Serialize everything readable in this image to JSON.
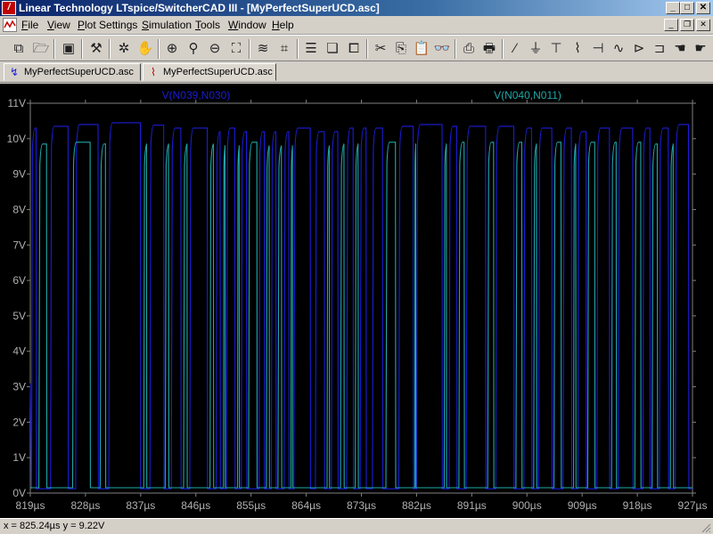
{
  "window": {
    "title": "Linear Technology LTspice/SwitcherCAD III - [MyPerfectSuperUCD.asc]",
    "minimize_glyph": "_",
    "maximize_glyph": "□",
    "close_glyph": "✕"
  },
  "menu": {
    "items": [
      "File",
      "View",
      "Plot Settings",
      "Simulation",
      "Tools",
      "Window",
      "Help"
    ]
  },
  "mdi": {
    "minimize_glyph": "_",
    "restore_glyph": "❐",
    "close_glyph": "✕"
  },
  "toolbar": {
    "icons": [
      "hierarchy-icon",
      "open-folder-icon",
      "save-icon",
      "control-panel-icon",
      "run-icon",
      "pan-hand-icon",
      "zoom-in-icon",
      "zoom-area-icon",
      "zoom-out-icon",
      "zoom-fit-icon",
      "autorange-icon",
      "delete-trace-icon",
      "tile-icon",
      "cascade-icon",
      "close-all-icon",
      "cut-icon",
      "copy-icon",
      "paste-icon",
      "find-icon",
      "print-preview-icon",
      "print-icon",
      "wire-icon",
      "ground-icon",
      "label-icon",
      "resistor-icon",
      "capacitor-icon",
      "inductor-icon",
      "diode-icon",
      "component-icon",
      "move-hand-icon",
      "drag-hand-icon"
    ]
  },
  "tabs": [
    {
      "label": "MyPerfectSuperUCD.asc",
      "icon": "schematic-icon"
    },
    {
      "label": "MyPerfectSuperUCD.asc",
      "icon": "waveform-icon"
    }
  ],
  "status": {
    "readout": "x = 825.24µs     y = 9.22V"
  },
  "chart_data": {
    "type": "line",
    "title": "",
    "xlabel": "",
    "ylabel": "",
    "xlim": [
      819,
      927
    ],
    "ylim": [
      0,
      11
    ],
    "x_ticks": [
      "819µs",
      "828µs",
      "837µs",
      "846µs",
      "855µs",
      "864µs",
      "873µs",
      "882µs",
      "891µs",
      "900µs",
      "909µs",
      "918µs",
      "927µs"
    ],
    "y_ticks": [
      "0V",
      "1V",
      "2V",
      "3V",
      "4V",
      "5V",
      "6V",
      "7V",
      "8V",
      "9V",
      "10V",
      "11V"
    ],
    "grid": false,
    "legend_placement": "top",
    "background_color": "#000000",
    "axis_color": "#808080",
    "series": [
      {
        "name": "V(N039,N030)",
        "color": "#1c1cd8",
        "low_v": 0.12,
        "high_v_typical": 10.3,
        "pulses": [
          [
            819.2,
            820.0,
            10.3
          ],
          [
            822.3,
            825.2,
            10.35
          ],
          [
            826.4,
            830.1,
            10.4
          ],
          [
            831.8,
            837.0,
            10.45
          ],
          [
            838.5,
            840.8,
            10.38
          ],
          [
            842.0,
            843.6,
            10.3
          ],
          [
            845.0,
            847.9,
            10.3
          ],
          [
            849.3,
            850.0,
            10.2
          ],
          [
            851.0,
            852.4,
            10.3
          ],
          [
            853.4,
            854.3,
            10.2
          ],
          [
            856.3,
            857.2,
            10.2
          ],
          [
            858.3,
            859.1,
            10.2
          ],
          [
            860.4,
            861.2,
            10.2
          ],
          [
            862.0,
            864.7,
            10.3
          ],
          [
            865.5,
            867.0,
            10.2
          ],
          [
            868.1,
            869.2,
            10.2
          ],
          [
            870.6,
            871.7,
            10.3
          ],
          [
            872.8,
            873.8,
            10.3
          ],
          [
            874.8,
            876.5,
            10.3
          ],
          [
            879.1,
            881.5,
            10.35
          ],
          [
            882.0,
            886.2,
            10.4
          ],
          [
            887.3,
            888.6,
            10.35
          ],
          [
            890.1,
            893.3,
            10.35
          ],
          [
            894.9,
            897.9,
            10.35
          ],
          [
            899.5,
            900.8,
            10.3
          ],
          [
            901.9,
            904.1,
            10.3
          ],
          [
            905.9,
            907.3,
            10.3
          ],
          [
            908.3,
            909.7,
            10.2
          ],
          [
            911.4,
            913.5,
            10.3
          ],
          [
            914.9,
            917.3,
            10.3
          ],
          [
            918.9,
            920.1,
            10.3
          ],
          [
            921.6,
            923.1,
            10.3
          ],
          [
            924.2,
            926.4,
            10.4
          ]
        ]
      },
      {
        "name": "V(N040,N011)",
        "color": "#20a8a8",
        "low_v": 0.15,
        "high_v_typical": 9.9,
        "pulses": [
          [
            820.4,
            821.7,
            9.85
          ],
          [
            825.9,
            828.8,
            9.9
          ],
          [
            830.4,
            831.3,
            9.85
          ],
          [
            837.5,
            838.0,
            9.85
          ],
          [
            841.0,
            841.6,
            9.85
          ],
          [
            844.0,
            844.6,
            9.85
          ],
          [
            848.3,
            848.9,
            9.85
          ],
          [
            850.5,
            850.8,
            9.8
          ],
          [
            852.8,
            853.1,
            9.8
          ],
          [
            854.6,
            856.0,
            9.9
          ],
          [
            857.5,
            858.0,
            9.8
          ],
          [
            859.4,
            860.0,
            9.8
          ],
          [
            861.5,
            861.8,
            9.8
          ],
          [
            867.4,
            867.8,
            9.8
          ],
          [
            869.6,
            870.2,
            9.85
          ],
          [
            872.0,
            872.5,
            9.85
          ],
          [
            877.0,
            878.6,
            9.9
          ],
          [
            881.7,
            881.9,
            9.85
          ],
          [
            886.5,
            886.9,
            9.85
          ],
          [
            888.9,
            889.8,
            9.9
          ],
          [
            893.6,
            894.6,
            9.9
          ],
          [
            898.2,
            899.2,
            9.9
          ],
          [
            901.1,
            901.6,
            9.85
          ],
          [
            904.4,
            905.6,
            9.9
          ],
          [
            907.6,
            908.0,
            9.85
          ],
          [
            909.9,
            911.1,
            9.9
          ],
          [
            913.8,
            914.6,
            9.9
          ],
          [
            917.6,
            918.6,
            9.9
          ],
          [
            920.4,
            921.3,
            9.85
          ],
          [
            923.4,
            923.9,
            9.85
          ]
        ]
      }
    ]
  }
}
